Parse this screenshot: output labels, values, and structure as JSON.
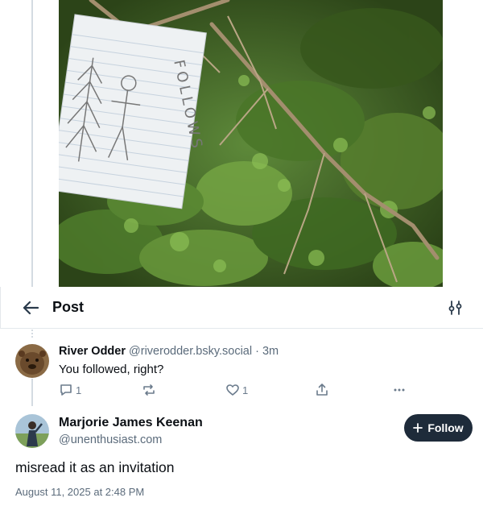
{
  "header": {
    "title": "Post",
    "back_icon": "arrow-left-icon",
    "filter_icon": "sliders-icon"
  },
  "image": {
    "description_icon": "forest-photo",
    "note_text": "FOLLOWS"
  },
  "reply": {
    "author_name": "River Odder",
    "author_handle": "@riverodder.bsky.social",
    "time": "· 3m",
    "text": "You followed, right?",
    "reply_count": "1",
    "like_count": "1"
  },
  "post": {
    "author_name": "Marjorie James Keenan",
    "author_handle": "@unenthusiast.com",
    "follow_label": "Follow",
    "text": "misread it as an invitation",
    "timestamp": "August 11, 2025 at 2:48 PM"
  },
  "colors": {
    "accent_dark": "#1e2b3a",
    "muted": "#5b6b7b",
    "divider": "#e4e8ec"
  }
}
